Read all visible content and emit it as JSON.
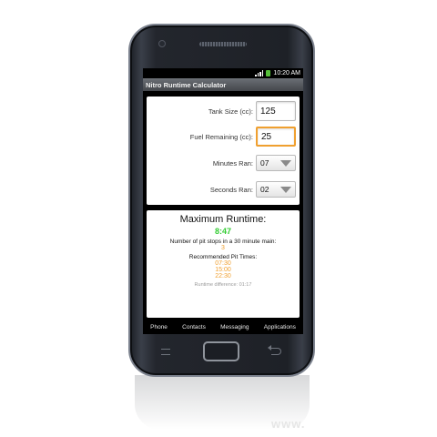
{
  "status_bar": {
    "time": "10:20 AM"
  },
  "app": {
    "title": "Nitro Runtime Calculator"
  },
  "inputs": {
    "tank_size": {
      "label": "Tank Size (cc):",
      "value": "125"
    },
    "fuel_remaining": {
      "label": "Fuel Remaining (cc):",
      "value": "25"
    },
    "minutes_ran": {
      "label": "Minutes Ran:",
      "value": "07"
    },
    "seconds_ran": {
      "label": "Seconds Ran:",
      "value": "02"
    }
  },
  "results": {
    "title": "Maximum Runtime:",
    "max_runtime": "8:47",
    "pit_stops_label": "Number of pit stops in a 30 minute main:",
    "pit_stops_value": "3",
    "pit_times_label": "Recommended Pit Times:",
    "pit_times": [
      "07:30",
      "15:00",
      "22:30"
    ],
    "runtime_difference": "Runtime difference: 01:17"
  },
  "dock": [
    "Phone",
    "Contacts",
    "Messaging",
    "Applications"
  ],
  "watermark": "www.",
  "colors": {
    "accent_green": "#33cc33",
    "accent_orange": "#f0a030",
    "focus_border": "#f0a030"
  }
}
